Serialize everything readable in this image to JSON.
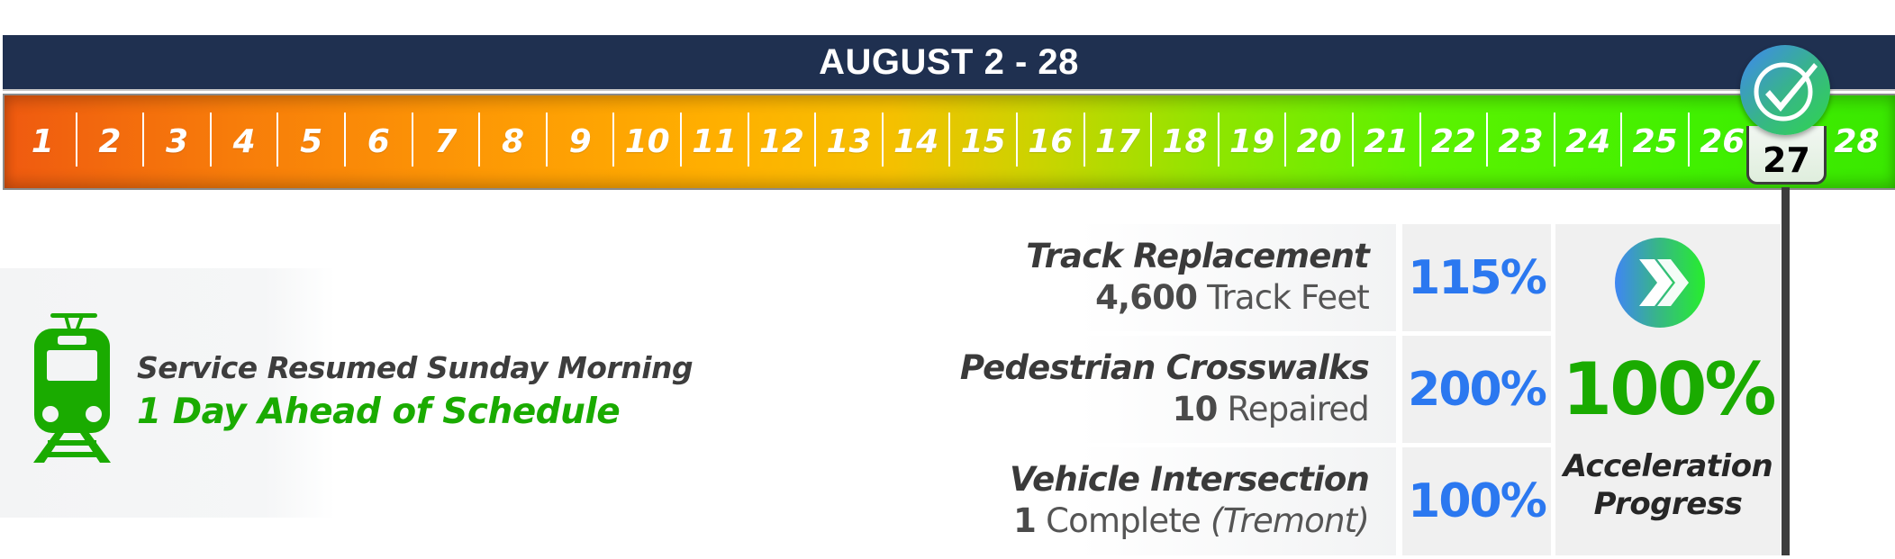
{
  "header": {
    "title": "AUGUST 2 - 28"
  },
  "timeline": {
    "days": [
      "1",
      "2",
      "3",
      "4",
      "5",
      "6",
      "7",
      "8",
      "9",
      "10",
      "11",
      "12",
      "13",
      "14",
      "15",
      "16",
      "17",
      "18",
      "19",
      "20",
      "21",
      "22",
      "23",
      "24",
      "25",
      "26",
      "27",
      "28"
    ],
    "current_day": "27",
    "current_day_icon": "check-circle-icon",
    "gradient_colors": [
      "#ef5a10",
      "#ffb000",
      "#3ae800"
    ]
  },
  "status": {
    "icon": "train-icon",
    "line1": "Service Resumed Sunday Morning",
    "line2": "1 Day Ahead of Schedule",
    "line2_color": "#1aab00"
  },
  "metrics": [
    {
      "title": "Track Replacement",
      "value": "4,600",
      "unit": "Track Feet",
      "note": "",
      "percent": "115%"
    },
    {
      "title": "Pedestrian Crosswalks",
      "value": "10",
      "unit": "Repaired",
      "note": "",
      "percent": "200%"
    },
    {
      "title": "Vehicle Intersection",
      "value": "1",
      "unit": "Complete",
      "note": "(Tremont)",
      "percent": "100%"
    }
  ],
  "acceleration": {
    "icon": "double-chevron-right-icon",
    "percent": "100%",
    "label_line1": "Acceleration",
    "label_line2": "Progress"
  },
  "colors": {
    "header_bg": "#1f3050",
    "percent_blue": "#2b78f0",
    "accent_green": "#1aab00"
  }
}
